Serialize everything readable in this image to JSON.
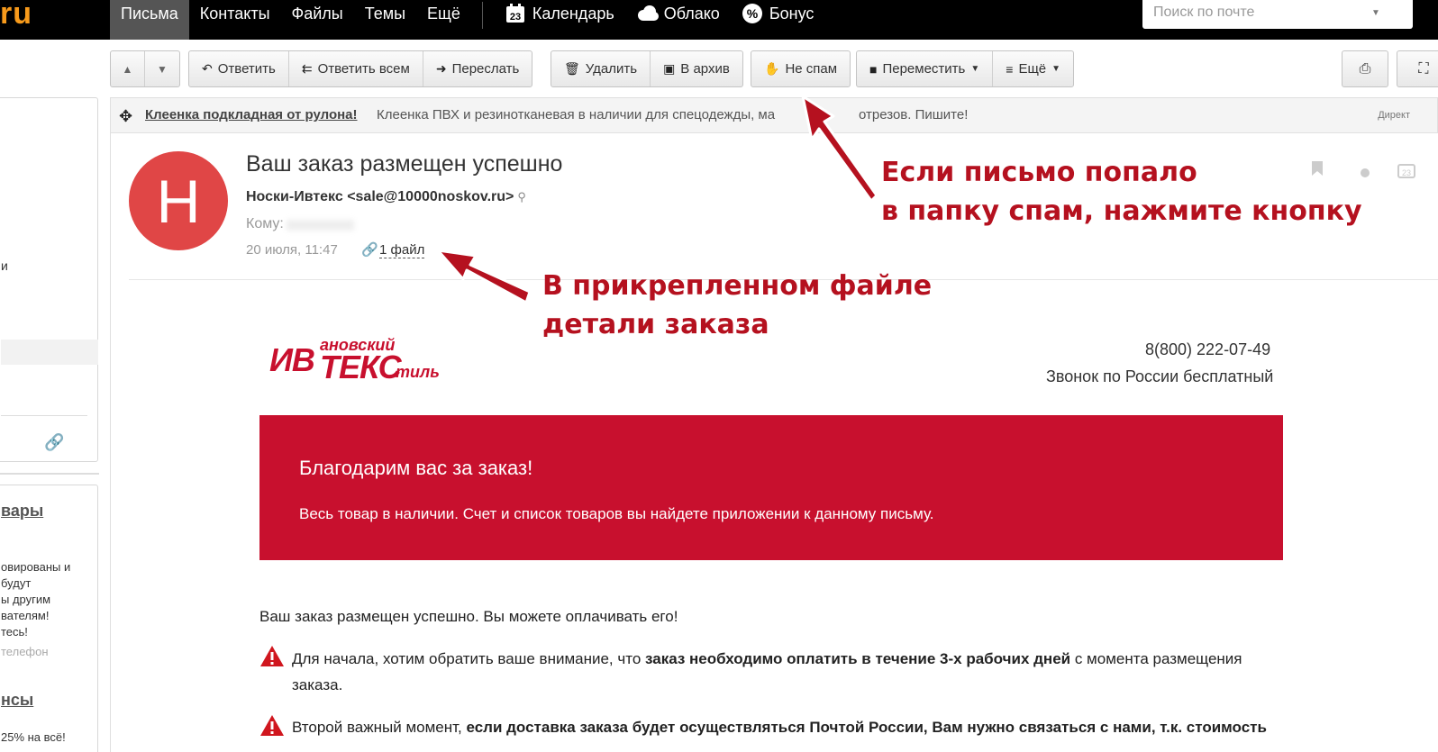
{
  "topbar": {
    "logo": "ru",
    "nav": [
      "Письма",
      "Контакты",
      "Файлы",
      "Темы",
      "Ещё"
    ],
    "services": [
      {
        "label": "Календарь",
        "icon": "calendar-icon",
        "badge": "23"
      },
      {
        "label": "Облако",
        "icon": "cloud-icon"
      },
      {
        "label": "Бонус",
        "icon": "bonus-percent-icon"
      }
    ],
    "search_placeholder": "Поиск по почте"
  },
  "toolbar": {
    "reply": "Ответить",
    "reply_all": "Ответить всем",
    "forward": "Переслать",
    "delete": "Удалить",
    "archive": "В архив",
    "not_spam": "Не спам",
    "move": "Переместить",
    "more": "Ещё"
  },
  "sidebar": {
    "text1": "и",
    "section1": "вары",
    "lines": [
      "овированы и",
      "будут",
      "ы другим",
      "вателям!",
      "тесь!"
    ],
    "phone_hint": "телефон",
    "section2": "нсы",
    "bottom": "25% на всё!"
  },
  "ad": {
    "link": "Клеенка подкладная от рулона!",
    "text": "Клеенка ПВХ и резинотканевая в наличии для спецодежды, ма",
    "text_tail": "отрезов. Пишите!",
    "label": "Директ"
  },
  "email": {
    "avatar_letter": "Н",
    "subject": "Ваш заказ размещен успешно",
    "sender": "Носки-Ивтекс <sale@10000noskov.ru>",
    "to_label": "Кому:",
    "date": "20 июля, 11:47",
    "attachment": "1 файл"
  },
  "body": {
    "brand": {
      "part1": "ИВ",
      "part2": "ановский",
      "part3": "ТЕКС",
      "part4": "тиль"
    },
    "phone": "8(800) 222-07-49",
    "free_call": "Звонок по России бесплатный",
    "thanks": "Благодарим вас за заказ!",
    "instock": "Весь товар в наличии. Счет и список товаров вы найдете приложении к данному письму.",
    "placed": "Ваш заказ размещен успешно. Вы можете оплачивать его!",
    "warn1_pre": "Для начала, хотим обратить ваше внимание, что ",
    "warn1_bold": "заказ необходимо оплатить в течение 3-х рабочих дней",
    "warn1_post": " с момента размещения заказа.",
    "warn2_pre": "Второй важный момент, ",
    "warn2_bold": "если доставка заказа будет осуществляться Почтой России, Вам нужно связаться с нами, т.к. стоимость"
  },
  "annotations": {
    "spam_line1": "Если письмо попало",
    "spam_line2": "в папку спам, нажмите кнопку",
    "file_line1": "В прикрепленном файле",
    "file_line2": "детали заказа"
  },
  "colors": {
    "accent_red": "#c8102e",
    "avatar": "#e04646",
    "logo_orange": "#f79a1b",
    "annotation": "#b5111f"
  }
}
